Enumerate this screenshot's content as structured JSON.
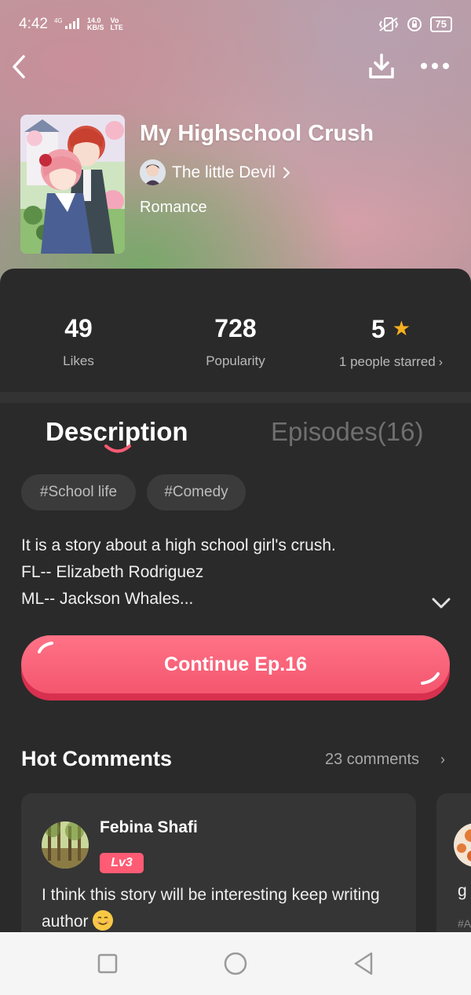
{
  "status_bar": {
    "time": "4:42",
    "net_top": "4G",
    "speed_value": "14.0",
    "speed_unit": "KB/S",
    "carrier_top": "Vo",
    "carrier_bottom": "LTE",
    "battery": "75"
  },
  "icons": {
    "back": "chevron-left-icon",
    "download": "download-icon",
    "more": "more-dots-icon",
    "author_chevron": "chevron-right-icon",
    "star": "star-icon",
    "expand": "chevron-down-icon"
  },
  "book": {
    "title": "My Highschool Crush",
    "author": "The little Devil",
    "genre": "Romance"
  },
  "stats": [
    {
      "value": "49",
      "label": "Likes"
    },
    {
      "value": "728",
      "label": "Popularity"
    },
    {
      "value": "5",
      "label": "1 people starred"
    }
  ],
  "tabs": {
    "description": "Description",
    "episodes": "Episodes(16)"
  },
  "tags": [
    "#School life",
    "#Comedy"
  ],
  "description_text": "It is a story about a high school girl's crush.\nFL-- Elizabeth Rodriguez\nML-- Jackson Whales...",
  "continue_label": "Continue Ep.16",
  "comments": {
    "title": "Hot Comments",
    "count_label": "23 comments",
    "items": [
      {
        "name": "Febina Shafi",
        "level": "Lv3",
        "text": "I think this story will be interesting keep writing author"
      },
      {
        "text": "g",
        "extra": "#A"
      }
    ]
  },
  "colors": {
    "accent": "#F4566F",
    "level_badge": "#FF5B74",
    "star": "#F6B01E",
    "sheet_bg": "#2A2A2A"
  }
}
